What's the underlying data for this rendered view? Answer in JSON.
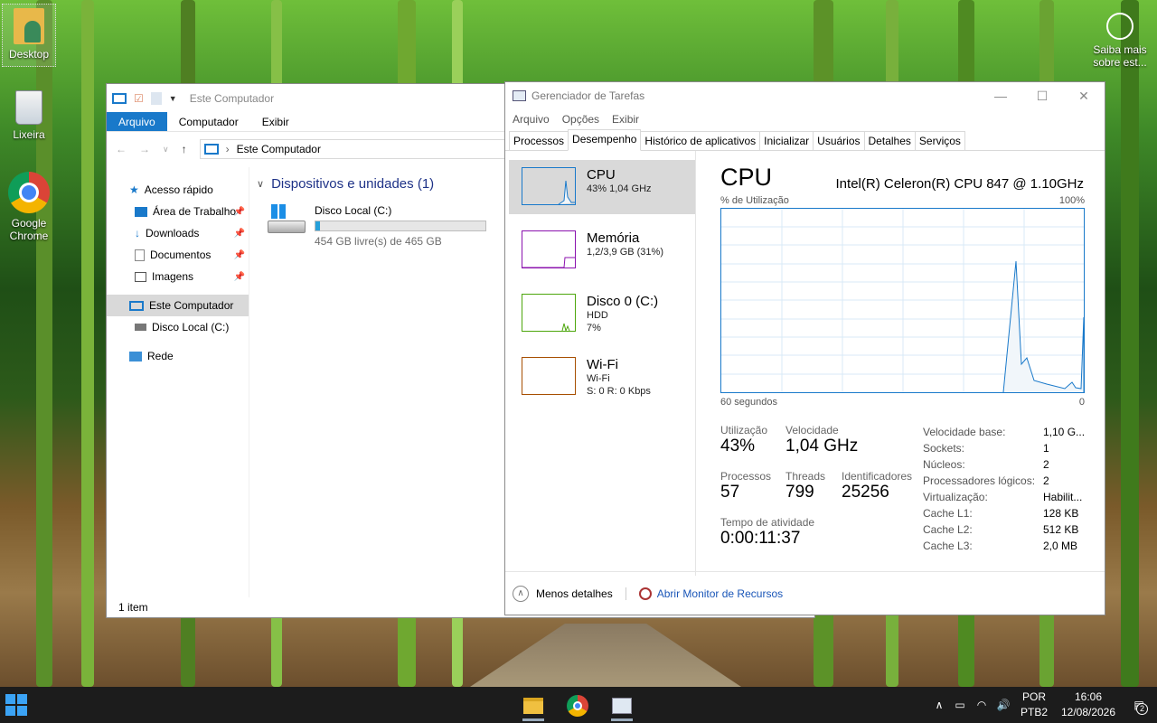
{
  "desktop": {
    "icons": [
      {
        "label": "Desktop"
      },
      {
        "label": "Lixeira"
      },
      {
        "label": "Google\nChrome"
      }
    ],
    "learn_more": "Saiba mais\nsobre est..."
  },
  "explorer": {
    "title": "Este Computador",
    "ribbon": {
      "file": "Arquivo",
      "computer": "Computador",
      "view": "Exibir"
    },
    "address": "Este Computador",
    "sidebar": [
      {
        "label": "Acesso rápido"
      },
      {
        "label": "Área de Trabalho"
      },
      {
        "label": "Downloads"
      },
      {
        "label": "Documentos"
      },
      {
        "label": "Imagens"
      },
      {
        "label": "Este Computador"
      },
      {
        "label": "Disco Local (C:)"
      },
      {
        "label": "Rede"
      }
    ],
    "group_title": "Dispositivos e unidades (1)",
    "drive": {
      "name": "Disco Local (C:)",
      "free": "454 GB livre(s) de 465 GB",
      "used_fraction": 0.024
    },
    "status": "1 item"
  },
  "taskmgr": {
    "title": "Gerenciador de Tarefas",
    "menu": {
      "file": "Arquivo",
      "options": "Opções",
      "view": "Exibir"
    },
    "tabs": [
      "Processos",
      "Desempenho",
      "Histórico de aplicativos",
      "Inicializar",
      "Usuários",
      "Detalhes",
      "Serviços"
    ],
    "resources": [
      {
        "name": "CPU",
        "sub1": "43% 1,04 GHz",
        "sub2": "",
        "color": "#1979ca"
      },
      {
        "name": "Memória",
        "sub1": "1,2/3,9 GB (31%)",
        "sub2": "",
        "color": "#8b12ae"
      },
      {
        "name": "Disco 0 (C:)",
        "sub1": "HDD",
        "sub2": "7%",
        "color": "#4da60c"
      },
      {
        "name": "Wi-Fi",
        "sub1": "Wi-Fi",
        "sub2": "S: 0 R: 0 Kbps",
        "color": "#a74f01"
      }
    ],
    "cpu": {
      "heading": "CPU",
      "model": "Intel(R) Celeron(R) CPU 847 @ 1.10GHz",
      "util_label": "% de Utilização",
      "max_label": "100%",
      "time_left": "60 segundos",
      "time_right": "0",
      "utilization_label": "Utilização",
      "utilization": "43%",
      "speed_label": "Velocidade",
      "speed": "1,04 GHz",
      "processes_label": "Processos",
      "processes": "57",
      "threads_label": "Threads",
      "threads": "799",
      "handles_label": "Identificadores",
      "handles": "25256",
      "uptime_label": "Tempo de atividade",
      "uptime": "0:00:11:37",
      "details": [
        {
          "k": "Velocidade base:",
          "v": "1,10 G..."
        },
        {
          "k": "Sockets:",
          "v": "1"
        },
        {
          "k": "Núcleos:",
          "v": "2"
        },
        {
          "k": "Processadores lógicos:",
          "v": "2"
        },
        {
          "k": "Virtualização:",
          "v": "Habilit..."
        },
        {
          "k": "Cache L1:",
          "v": "128 KB"
        },
        {
          "k": "Cache L2:",
          "v": "512 KB"
        },
        {
          "k": "Cache L3:",
          "v": "2,0 MB"
        }
      ]
    },
    "footer": {
      "less": "Menos detalhes",
      "monitor": "Abrir Monitor de Recursos"
    }
  },
  "taskbar": {
    "lang1": "POR",
    "lang2": "PTB2",
    "time": "16:06",
    "date": "12/08/2026",
    "notif_count": "2"
  }
}
